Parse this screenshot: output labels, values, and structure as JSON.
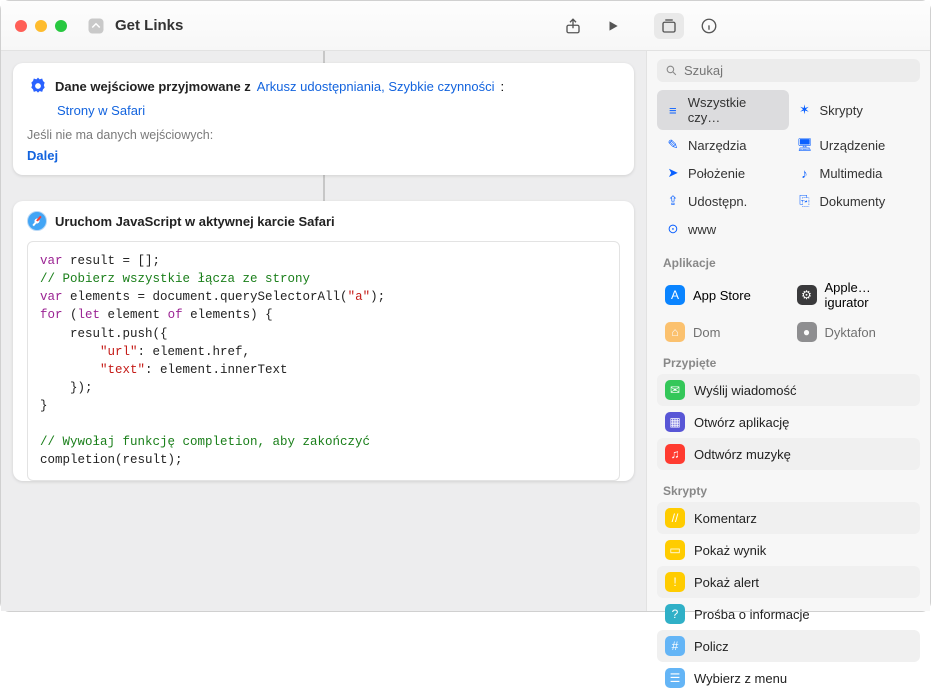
{
  "window": {
    "title": "Get Links"
  },
  "inputCard": {
    "receivesLabel": "Dane wejściowe przyjmowane z",
    "receivesValue": "Arkusz udostępniania, Szybkie czynności",
    "colon": ":",
    "subtypeValue": "Strony w Safari",
    "noInputLabel": "Jeśli nie ma danych wejściowych:",
    "noInputValue": "Dalej"
  },
  "actionCard": {
    "title": "Uruchom JavaScript w aktywnej karcie Safari",
    "code": {
      "l1a": "var",
      "l1b": " result = [];",
      "l2": "// Pobierz wszystkie łącza ze strony",
      "l3a": "var",
      "l3b": " elements = document.querySelectorAll(",
      "l3c": "\"a\"",
      "l3d": ");",
      "l4a": "for",
      "l4b": " (",
      "l4c": "let",
      "l4d": " element ",
      "l4e": "of",
      "l4f": " elements) {",
      "l5": "    result.push({",
      "l6a": "        ",
      "l6b": "\"url\"",
      "l6c": ": element.href,",
      "l7a": "        ",
      "l7b": "\"text\"",
      "l7c": ": element.innerText",
      "l8": "    });",
      "l9": "}",
      "l10": "",
      "l11": "// Wywołaj funkcję completion, aby zakończyć",
      "l12": "completion(result);"
    }
  },
  "sidebar": {
    "searchPlaceholder": "Szukaj",
    "categories": [
      {
        "label": "Wszystkie czy…",
        "glyph": "≡"
      },
      {
        "label": "Skrypty",
        "glyph": "✶"
      },
      {
        "label": "Narzędzia",
        "glyph": "✎"
      },
      {
        "label": "Urządzenie",
        "glyph": "🖥"
      },
      {
        "label": "Położenie",
        "glyph": "➤"
      },
      {
        "label": "Multimedia",
        "glyph": "♪"
      },
      {
        "label": "Udostępn.",
        "glyph": "⇪"
      },
      {
        "label": "Dokumenty",
        "glyph": "⎘"
      },
      {
        "label": "www",
        "glyph": "⊙"
      }
    ],
    "appsLabel": "Aplikacje",
    "apps": [
      {
        "label": "App Store",
        "color": "blue"
      },
      {
        "label": "Apple…igurator",
        "color": "dark"
      },
      {
        "label": "Dom",
        "color": "orange"
      },
      {
        "label": "Dyktafon",
        "color": "dark"
      }
    ],
    "pinnedLabel": "Przypięte",
    "pinned": [
      {
        "label": "Wyślij wiadomość",
        "color": "green"
      },
      {
        "label": "Otwórz aplikację",
        "color": "purple"
      },
      {
        "label": "Odtwórz muzykę",
        "color": "red"
      }
    ],
    "scriptsLabel": "Skrypty",
    "scripts": [
      {
        "label": "Komentarz",
        "color": "yellow"
      },
      {
        "label": "Pokaż wynik",
        "color": "yellow"
      },
      {
        "label": "Pokaż alert",
        "color": "yellow"
      },
      {
        "label": "Prośba o informacje",
        "color": "teal"
      },
      {
        "label": "Policz",
        "color": "lightblue"
      },
      {
        "label": "Wybierz z menu",
        "color": "lightblue"
      }
    ]
  }
}
